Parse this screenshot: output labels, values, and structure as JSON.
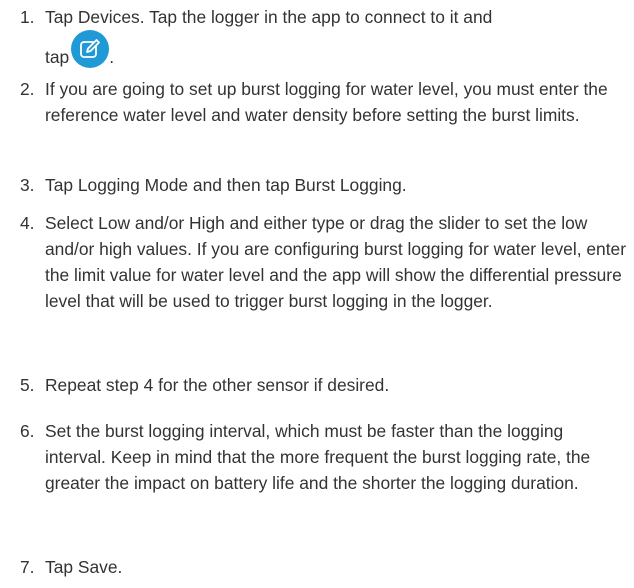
{
  "steps": [
    {
      "number": "1.",
      "text": "Tap Devices. Tap the logger in the app to connect to it and",
      "text_after": "tap",
      "text_end": "."
    },
    {
      "number": "2.",
      "text": "If you are going to set up burst logging for water level, you must enter the reference water level and water density before setting the burst limits."
    },
    {
      "number": "3.",
      "text": "Tap Logging Mode and then tap Burst Logging."
    },
    {
      "number": "4.",
      "text": "Select Low and/or High and either type or drag the slider to set the low and/or high values. If you are configuring burst logging for water level, enter the limit value for water level and the app will show the differential pressure level that will be used to trigger burst logging in the logger."
    },
    {
      "number": "5.",
      "text": "Repeat step 4 for the other sensor if desired."
    },
    {
      "number": "6.",
      "text": "Set the burst logging interval, which must be faster than the logging interval. Keep in mind that the more frequent the burst logging rate, the greater the impact on battery life and the shorter the logging duration."
    },
    {
      "number": "7.",
      "text": "Tap Save."
    }
  ],
  "icons": {
    "edit": "edit-icon",
    "edit_color": "#1f9ad6"
  }
}
